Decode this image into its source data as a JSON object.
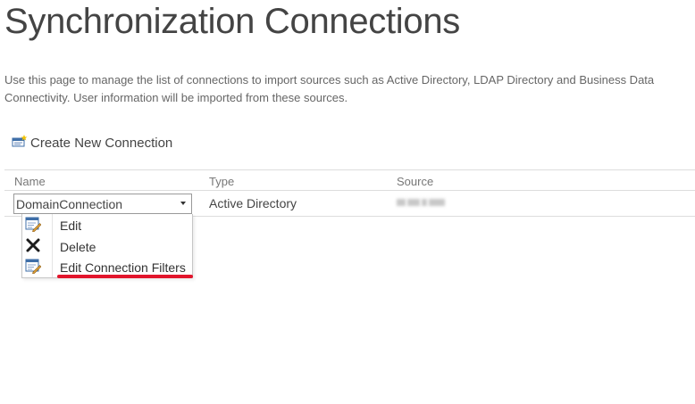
{
  "page": {
    "title": "Synchronization Connections",
    "description": "Use this page to manage the list of connections to import sources such as Active Directory, LDAP Directory and Business Data Connectivity. User information will be imported from these sources."
  },
  "toolbar": {
    "create_label": "Create New Connection",
    "create_icon": "new-connection-icon"
  },
  "table": {
    "headers": [
      "Name",
      "Type",
      "Source"
    ],
    "rows": [
      {
        "name": "DomainConnection",
        "type": "Active Directory",
        "source": ""
      }
    ]
  },
  "context_menu": {
    "items": [
      {
        "label": "Edit",
        "icon": "edit-icon"
      },
      {
        "label": "Delete",
        "icon": "delete-icon"
      },
      {
        "label": "Edit Connection Filters",
        "icon": "edit-filters-icon"
      }
    ]
  },
  "colors": {
    "annotation_underline": "#e2152c",
    "text": "#444444",
    "rule": "#dddddd"
  }
}
